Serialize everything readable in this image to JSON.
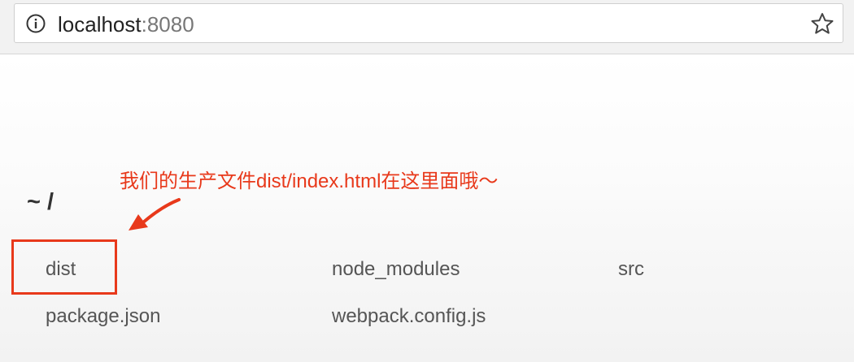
{
  "browser": {
    "url_host": "localhost",
    "url_port": ":8080",
    "info_icon": "info-icon",
    "bookmark_icon": "star-icon"
  },
  "listing": {
    "title": "~ /",
    "files": [
      "dist",
      "node_modules",
      "src",
      "package.json",
      "webpack.config.js"
    ]
  },
  "annotation": {
    "text": "我们的生产文件dist/index.html在这里面哦～",
    "color": "#e8391b"
  }
}
